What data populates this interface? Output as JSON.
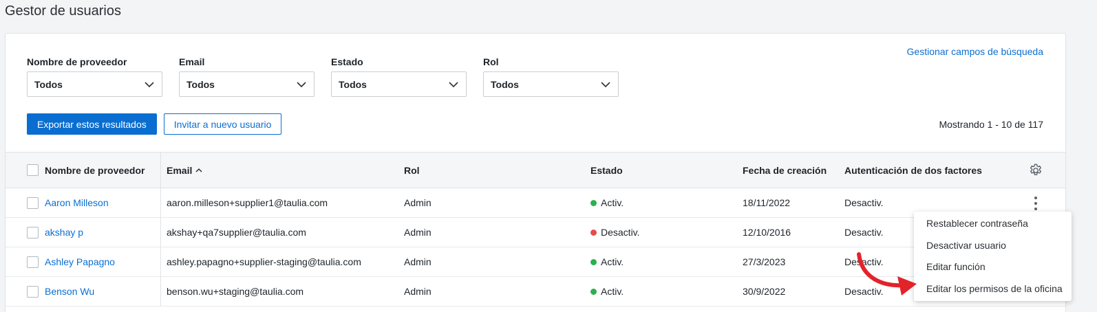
{
  "page": {
    "title": "Gestor de usuarios"
  },
  "search": {
    "manage_link": "Gestionar campos de búsqueda"
  },
  "filters": [
    {
      "label": "Nombre de proveedor",
      "value": "Todos"
    },
    {
      "label": "Email",
      "value": "Todos"
    },
    {
      "label": "Estado",
      "value": "Todos"
    },
    {
      "label": "Rol",
      "value": "Todos"
    }
  ],
  "actions": {
    "export_label": "Exportar estos resultados",
    "invite_label": "Invitar a nuevo usuario"
  },
  "pagination": {
    "summary": "Mostrando 1 - 10 de 117"
  },
  "table": {
    "headers": [
      "Nombre de proveedor",
      "Email",
      "Rol",
      "Estado",
      "Fecha de creación",
      "Autenticación de dos factores"
    ],
    "sorted_column": "Email",
    "rows": [
      {
        "name": "Aaron Milleson",
        "email": "aaron.milleson+supplier1@taulia.com",
        "role": "Admin",
        "status": "Activ.",
        "status_color": "#2bb04f",
        "created": "18/11/2022",
        "two_factor": "Desactiv."
      },
      {
        "name": "akshay p",
        "email": "akshay+qa7supplier@taulia.com",
        "role": "Admin",
        "status": "Desactiv.",
        "status_color": "#e84a4a",
        "created": "12/10/2016",
        "two_factor": "Desactiv."
      },
      {
        "name": "Ashley Papagno",
        "email": "ashley.papagno+supplier-staging@taulia.com",
        "role": "Admin",
        "status": "Activ.",
        "status_color": "#2bb04f",
        "created": "27/3/2023",
        "two_factor": "Desactiv."
      },
      {
        "name": "Benson Wu",
        "email": "benson.wu+staging@taulia.com",
        "role": "Admin",
        "status": "Activ.",
        "status_color": "#2bb04f",
        "created": "30/9/2022",
        "two_factor": "Desactiv."
      }
    ]
  },
  "context_menu": {
    "items": [
      "Restablecer contraseña",
      "Desactivar usuario",
      "Editar función",
      "Editar los permisos de la oficina"
    ]
  },
  "colors": {
    "accent": "#0a6ed1",
    "annotation_arrow": "#e3232a"
  }
}
